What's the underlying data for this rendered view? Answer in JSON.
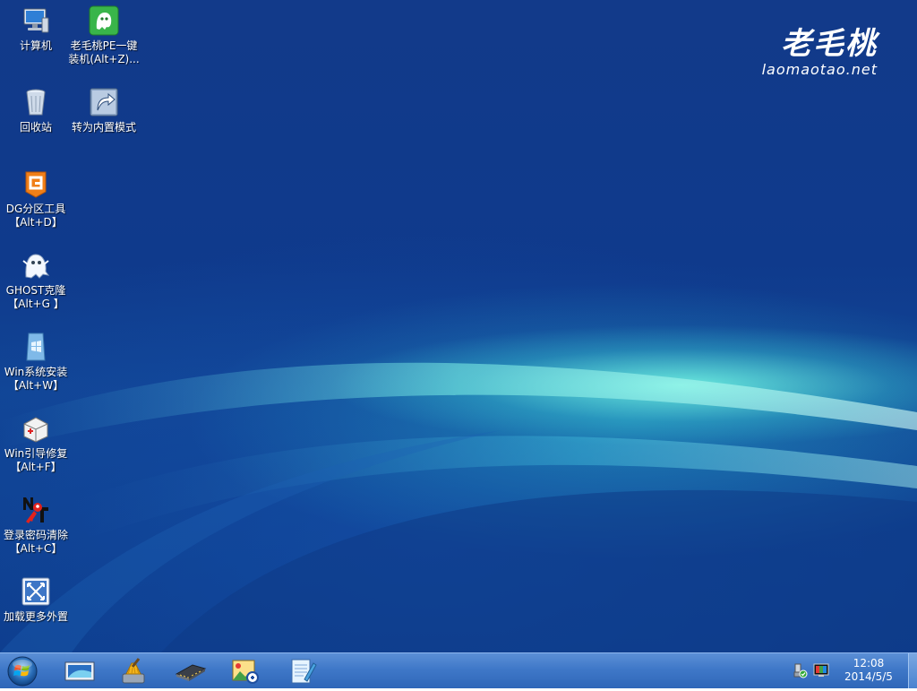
{
  "desktop": {
    "brand": {
      "name": "老毛桃",
      "url": "laomaotao.net"
    },
    "icons": [
      {
        "line1": "计算机",
        "line2": "",
        "icon": "computer-icon"
      },
      {
        "line1": "老毛桃PE一键",
        "line2": "装机(Alt+Z)...",
        "icon": "laomaotao-installer-icon"
      },
      {
        "line1": "回收站",
        "line2": "",
        "icon": "recycle-bin-icon"
      },
      {
        "line1": "转为内置模式",
        "line2": "",
        "icon": "shortcut-icon"
      },
      {
        "line1": "DG分区工具",
        "line2": "【Alt+D】",
        "icon": "diskgenius-icon"
      },
      {
        "line1": "GHOST克隆",
        "line2": "【Alt+G 】",
        "icon": "ghost-icon"
      },
      {
        "line1": "Win系统安装",
        "line2": "【Alt+W】",
        "icon": "windows-install-icon"
      },
      {
        "line1": "Win引导修复",
        "line2": "【Alt+F】",
        "icon": "boot-repair-icon"
      },
      {
        "line1": "登录密码清除",
        "line2": "【Alt+C】",
        "icon": "password-clear-icon"
      },
      {
        "line1": "加载更多外置",
        "line2": "",
        "icon": "load-more-icon"
      }
    ]
  },
  "taskbar": {
    "start": {
      "icon": "windows-orb-icon"
    },
    "pinned": [
      {
        "icon": "monitor-icon"
      },
      {
        "icon": "broom-cleaner-icon"
      },
      {
        "icon": "memory-chip-icon"
      },
      {
        "icon": "image-tools-icon"
      },
      {
        "icon": "notepad-icon"
      }
    ],
    "tray": [
      {
        "icon": "usb-safe-remove-icon"
      },
      {
        "icon": "display-color-icon"
      }
    ],
    "clock": {
      "time": "12:08",
      "date": "2014/5/5"
    }
  }
}
